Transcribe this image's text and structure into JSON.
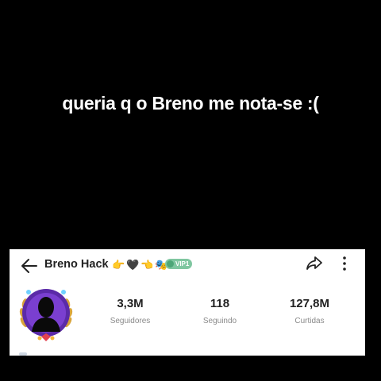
{
  "caption": "queria q o Breno me nota-se :(",
  "profile": {
    "name": "Breno Hack",
    "emojis": [
      "👉",
      "🖤",
      "👈",
      "🎭"
    ],
    "vip_label": "VIP1"
  },
  "stats": [
    {
      "value": "3,3M",
      "label": "Seguidores"
    },
    {
      "value": "118",
      "label": "Seguindo"
    },
    {
      "value": "127,8M",
      "label": "Curtidas"
    }
  ],
  "icons": {
    "back": "arrow-left-icon",
    "share": "share-arrow-icon",
    "more": "more-vertical-icon"
  },
  "colors": {
    "background": "#000000",
    "card": "#ffffff",
    "vip": "#7fc6a0",
    "avatar_ring": "#5b2aa8"
  }
}
